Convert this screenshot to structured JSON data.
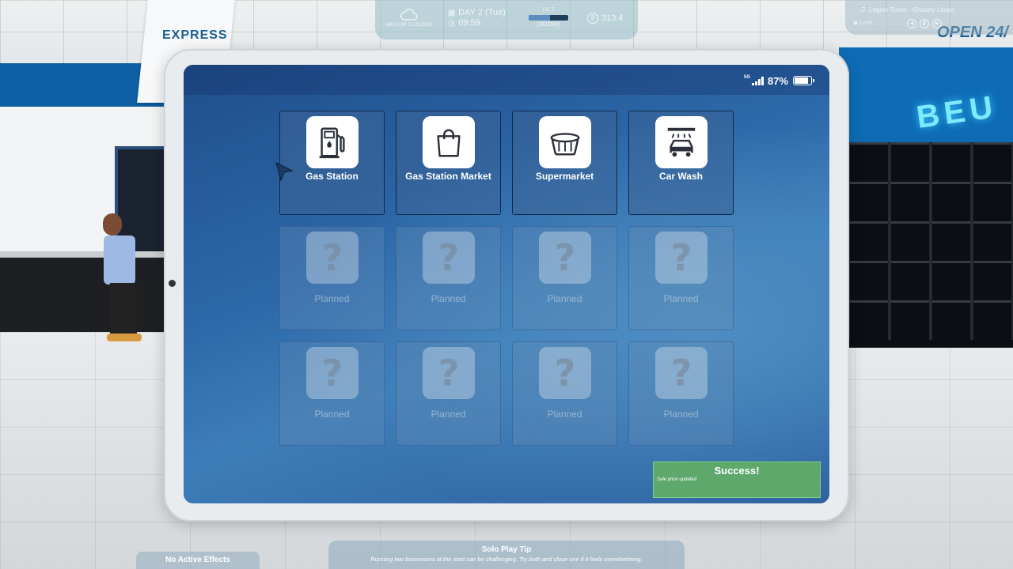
{
  "hud": {
    "weather": "MEDIUM CLOUDED",
    "day": "DAY 2 (Tue)",
    "time": "09:59",
    "level": "LV. 1",
    "xp": "[161/300]",
    "xp_fraction": 0.54,
    "money": "313.4",
    "music_title": "Legion Tunes - Grocery Loops",
    "music_genre": "Lo-Fi"
  },
  "scene": {
    "sign_express": "EXPRESS",
    "sign_open": "OPEN 24/",
    "neon": "BEU"
  },
  "tablet": {
    "network": "5G",
    "battery": "87%",
    "battery_fraction": 0.87,
    "apps": [
      {
        "label": "Gas Station",
        "icon": "fuel-pump-icon",
        "locked": false
      },
      {
        "label": "Gas Station Market",
        "icon": "shopping-bag-icon",
        "locked": false
      },
      {
        "label": "Supermarket",
        "icon": "basket-icon",
        "locked": false
      },
      {
        "label": "Car Wash",
        "icon": "car-wash-icon",
        "locked": false
      },
      {
        "label": "Planned",
        "icon": "question-icon",
        "locked": true
      },
      {
        "label": "Planned",
        "icon": "question-icon",
        "locked": true
      },
      {
        "label": "Planned",
        "icon": "question-icon",
        "locked": true
      },
      {
        "label": "Planned",
        "icon": "question-icon",
        "locked": true
      },
      {
        "label": "Planned",
        "icon": "question-icon",
        "locked": true
      },
      {
        "label": "Planned",
        "icon": "question-icon",
        "locked": true
      },
      {
        "label": "Planned",
        "icon": "question-icon",
        "locked": true
      },
      {
        "label": "Planned",
        "icon": "question-icon",
        "locked": true
      }
    ],
    "toast": {
      "title": "Success!",
      "message": "Sale price updated"
    }
  },
  "bottom": {
    "effects": "No Active Effects",
    "tip_title": "Solo Play Tip",
    "tip_body": "Running two businesses at the start can be challenging. Try both and close one if it feels overwhelming."
  }
}
